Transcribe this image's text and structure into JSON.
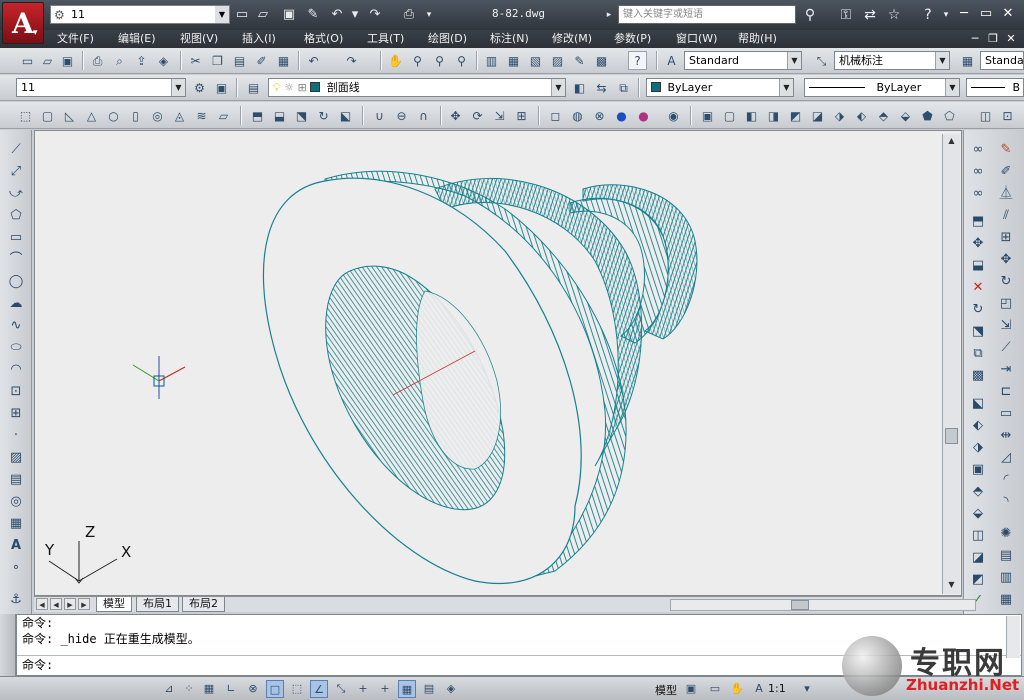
{
  "titlebar": {
    "workspace": "11",
    "title": "8-82.dwg",
    "search_placeholder": "键入关键字或短语"
  },
  "menus": [
    "文件(F)",
    "编辑(E)",
    "视图(V)",
    "插入(I)",
    "格式(O)",
    "工具(T)",
    "绘图(D)",
    "标注(N)",
    "修改(M)",
    "参数(P)",
    "窗口(W)",
    "帮助(H)"
  ],
  "toolbar2": {
    "text_style": "Standard",
    "dim_style": "机械标注",
    "table_style": "Standa"
  },
  "toolbar3": {
    "view_combo": "11",
    "layer": "剖面线",
    "color": "ByLayer",
    "linetype": "ByLayer",
    "lineweight": "B",
    "accent": "#0e6e7e"
  },
  "tabs": {
    "items": [
      "模型",
      "布局1",
      "布局2"
    ],
    "active": 0
  },
  "ucs": {
    "x": "X",
    "y": "Y",
    "z": "Z"
  },
  "command": {
    "line1": "命令:",
    "line2": "命令: _hide 正在重生成模型。",
    "prompt": "命令:"
  },
  "status": {
    "model_label": "模型",
    "scale": "1:1"
  },
  "watermark": {
    "chinese": "专职网",
    "site": "Zhuanzhi.Net"
  },
  "colors": {
    "wire": "#17808e",
    "bg": "#ededed",
    "title_bg": "#2f353c"
  }
}
